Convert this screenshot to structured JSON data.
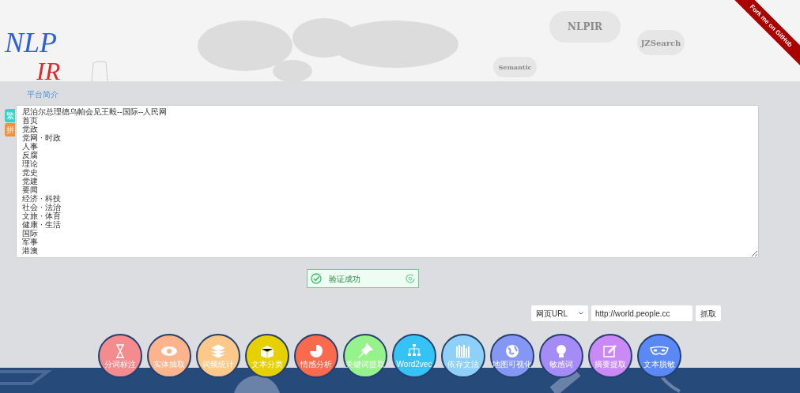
{
  "header": {
    "logo": {
      "top": "NLP",
      "bottom": "IR"
    },
    "clouds": [
      "NLPIR",
      "JZSearch",
      "Semantic"
    ],
    "ribbon": "Fork me on GitHub"
  },
  "intro_link": "平台简介",
  "side_tabs": [
    {
      "label": "繁",
      "color": "#33d6c8"
    },
    {
      "label": "拼",
      "color": "#f7903a"
    }
  ],
  "text_area": {
    "lines": [
      "尼泊尔总理德乌帕会见王毅--国际--人民网",
      "首页",
      "党政",
      "党网 · 时政",
      "人事",
      "反腐",
      "理论",
      "党史",
      "党建",
      "要闻",
      "经济 · 科技",
      "社会 · 法治",
      "文旅 · 体育",
      "健康 · 生活",
      "国际",
      "军事",
      "港澳"
    ]
  },
  "captcha": {
    "message": "验证成功",
    "verified": true
  },
  "fetch": {
    "source": "网页URL",
    "url": "http://world.people.cc",
    "button": "抓取"
  },
  "tools": [
    {
      "label": "分词标注",
      "kind": "hourglass",
      "color": "#f48b8e"
    },
    {
      "label": "实体抽取",
      "kind": "eye",
      "color": "#fdb38b"
    },
    {
      "label": "词频统计",
      "kind": "layers",
      "color": "#fdc98a"
    },
    {
      "label": "文本分类",
      "kind": "box",
      "color": "#e6d000"
    },
    {
      "label": "情感分析",
      "kind": "pie",
      "color": "#fb6a4c"
    },
    {
      "label": "关键词提取",
      "kind": "pin",
      "color": "#96f28a"
    },
    {
      "label": "Word2vec",
      "kind": "tree",
      "color": "#35c3f6"
    },
    {
      "label": "依存文法",
      "kind": "books",
      "color": "#8ed0f9"
    },
    {
      "label": "地图可视化",
      "kind": "globe",
      "color": "#8597f5"
    },
    {
      "label": "敏感词",
      "kind": "bulb",
      "color": "#a58bf6"
    },
    {
      "label": "摘要提取",
      "kind": "edit",
      "color": "#c98af6"
    },
    {
      "label": "文本脱敏",
      "kind": "mask",
      "color": "#5a88f5"
    }
  ]
}
